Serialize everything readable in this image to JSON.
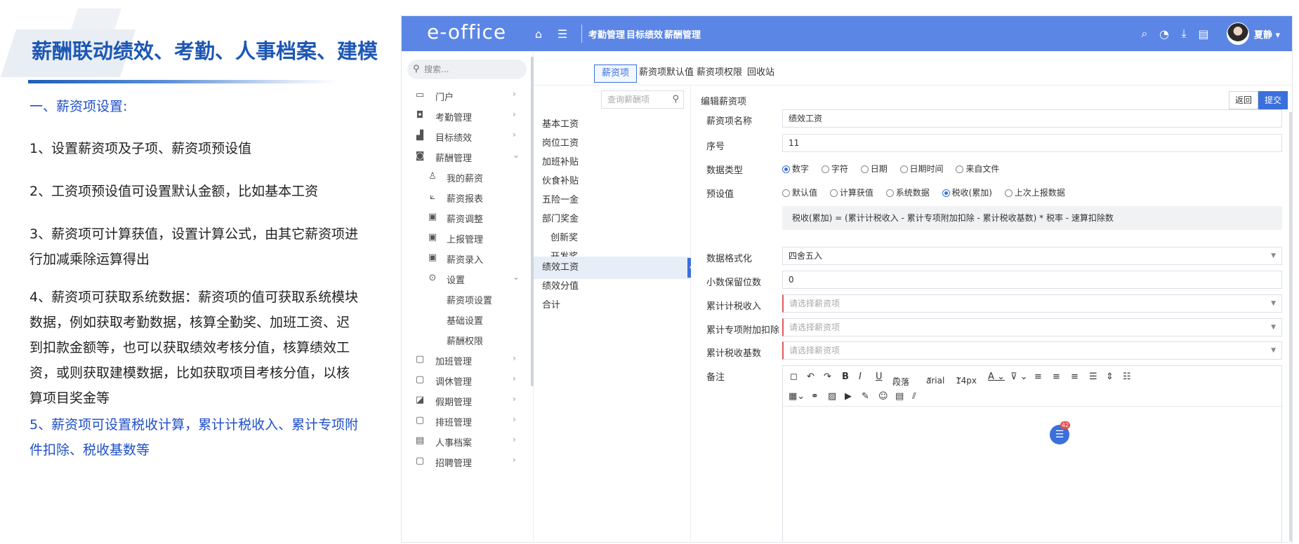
{
  "slide": {
    "title": "薪酬联动绩效、考勤、人事档案、建模",
    "section_heading": "一、薪资项设置:",
    "points": [
      "1、设置薪资项及子项、薪资项预设值",
      "2、工资项预设值可设置默认金额，比如基本工资",
      "3、薪资项可计算获值，设置计算公式，由其它薪资项进行加减乘除运算得出",
      "4、薪资项可获取系统数据：薪资项的值可获取系统模块数据，例如获取考勤数据，核算全勤奖、加班工资、迟到扣款金额等，也可以获取绩效考核分值，核算绩效工资，或则获取建模数据，比如获取项目考核分值，以核算项目奖金等",
      "5、薪资项可设置税收计算，累计计税收入、累计专项附件扣除、税收基数等"
    ]
  },
  "app": {
    "logo": "e-office",
    "top_links": [
      "考勤管理",
      "目标绩效",
      "薪酬管理"
    ],
    "user_name": "夏静",
    "colors": {
      "brand": "#5b86e5",
      "accent": "#3a6fdc",
      "required": "#e05a5a"
    }
  },
  "sidebar": {
    "search_placeholder": "搜索...",
    "items": [
      {
        "label": "门户",
        "icon": "portal-icon"
      },
      {
        "label": "考勤管理",
        "icon": "attendance-icon"
      },
      {
        "label": "目标绩效",
        "icon": "chart-icon"
      },
      {
        "label": "薪酬管理",
        "icon": "salary-icon"
      },
      {
        "label": "我的薪资",
        "icon": "person-icon"
      },
      {
        "label": "薪资报表",
        "icon": "line-chart-icon"
      },
      {
        "label": "薪资调整",
        "icon": "adjust-icon"
      },
      {
        "label": "上报管理",
        "icon": "report-icon"
      },
      {
        "label": "薪资录入",
        "icon": "entry-icon"
      },
      {
        "label": "设置",
        "icon": "settings-icon"
      },
      {
        "label": "薪资项设置",
        "icon": ""
      },
      {
        "label": "基础设置",
        "icon": ""
      },
      {
        "label": "薪酬权限",
        "icon": ""
      },
      {
        "label": "加班管理",
        "icon": "overtime-icon"
      },
      {
        "label": "调休管理",
        "icon": "leave-swap-icon"
      },
      {
        "label": "假期管理",
        "icon": "holiday-icon"
      },
      {
        "label": "排班管理",
        "icon": "schedule-icon"
      },
      {
        "label": "人事档案",
        "icon": "hr-file-icon"
      },
      {
        "label": "招聘管理",
        "icon": "recruit-icon"
      }
    ]
  },
  "tabs": [
    "薪资项",
    "薪资项默认值",
    "薪资项权限",
    "回收站"
  ],
  "list": {
    "search_placeholder": "查询薪酬项",
    "items": [
      "基本工资",
      "岗位工资",
      "加班补贴",
      "伙食补贴",
      "五险一金",
      "部门奖金",
      "创新奖",
      "开发奖",
      "绩效工资",
      "绩效分值",
      "合计"
    ]
  },
  "form": {
    "header": "编辑薪资项",
    "back_label": "返回",
    "submit_label": "提交",
    "name_label": "薪资项名称",
    "name_value": "绩效工资",
    "order_label": "序号",
    "order_value": "11",
    "data_type_label": "数据类型",
    "data_type_options": [
      "数字",
      "字符",
      "日期",
      "日期时间",
      "来自文件"
    ],
    "data_type_selected": "数字",
    "preset_label": "预设值",
    "preset_options": [
      "默认值",
      "计算获值",
      "系统数据",
      "税收(累加)",
      "上次上报数据"
    ],
    "preset_selected": "税收(累加)",
    "formula": "税收(累加) = (累计计税收入 - 累计专项附加扣除 - 累计税收基数) * 税率 - 速算扣除数",
    "format_label": "数据格式化",
    "format_value": "四舍五入",
    "decimals_label": "小数保留位数",
    "decimals_value": "0",
    "taxable_label": "累计计税收入",
    "taxable_placeholder": "请选择薪资项",
    "deduction_label": "累计专项附加扣除",
    "deduction_placeholder": "请选择薪资项",
    "taxbase_label": "累计税收基数",
    "taxbase_placeholder": "请选择薪资项",
    "remark_label": "备注",
    "editor": {
      "paragraph": "段落",
      "font": "arial",
      "size": "14px"
    }
  },
  "chat": {
    "badge": "42"
  }
}
